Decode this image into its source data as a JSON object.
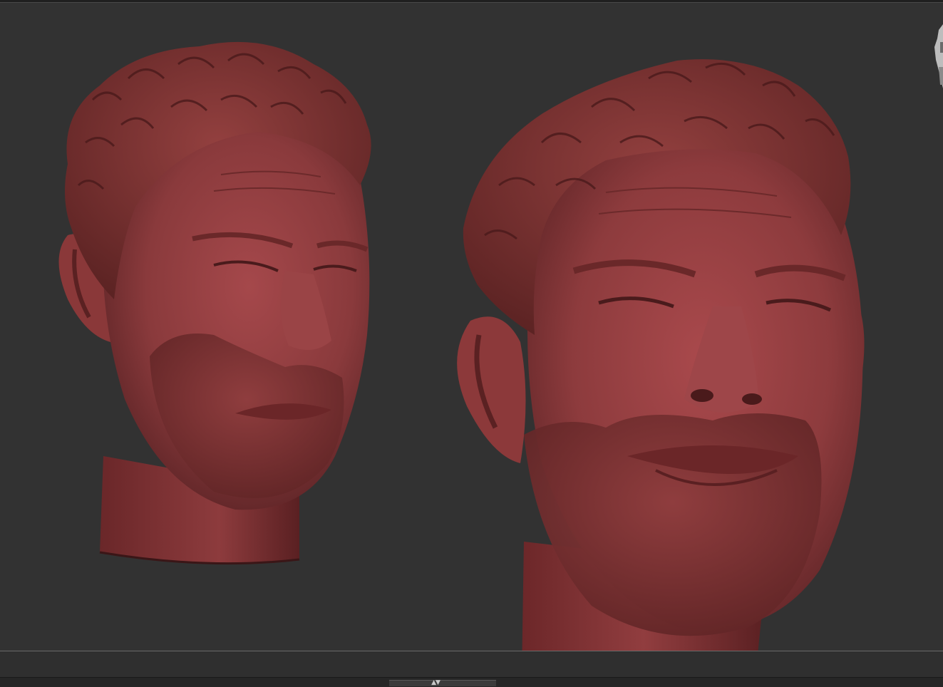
{
  "app": {
    "type": "3D sculpting viewport",
    "background_color": "#323232",
    "model_color": "#8a3a3a"
  },
  "viewport": {
    "objects": [
      {
        "name": "head-model-left",
        "view": "three-quarter"
      },
      {
        "name": "head-model-right",
        "view": "low-angle front"
      }
    ]
  },
  "navigation": {
    "icon": "navigation-cube-icon"
  },
  "tray": {
    "toggle_icon": "tray-toggle-arrows-icon",
    "toggle_glyph": "▲▼"
  }
}
